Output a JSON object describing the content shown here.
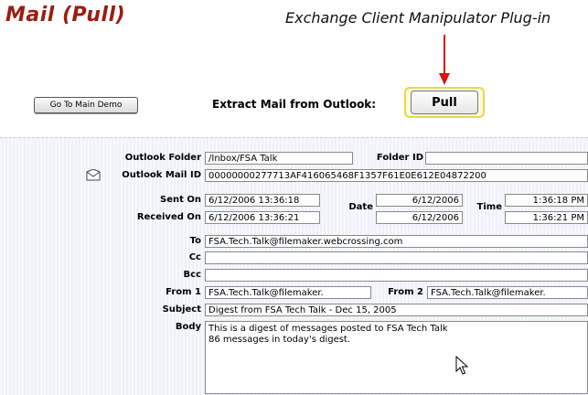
{
  "header": {
    "title": "Mail (Pull)",
    "subtitle": "Exchange Client Manipulator Plug-in"
  },
  "toolbar": {
    "go_to_main_demo": "Go To Main Demo",
    "extract_label": "Extract Mail from Outlook:",
    "pull_label": "Pull"
  },
  "form": {
    "outlook_folder_label": "Outlook Folder",
    "outlook_folder_value": "/Inbox/FSA Talk",
    "folder_id_label": "Folder ID",
    "folder_id_value": "",
    "mail_id_label": "Outlook Mail ID",
    "mail_id_value": "00000000277713AF416065468F1357F61E0E612E04872200",
    "sent_on_label": "Sent On",
    "sent_on_value": "6/12/2006 13:36:18",
    "received_on_label": "Received On",
    "received_on_value": "6/12/2006 13:36:21",
    "date_label": "Date",
    "sent_date_value": "6/12/2006",
    "received_date_value": "6/12/2006",
    "time_label": "Time",
    "sent_time_value": "1:36:18 PM",
    "received_time_value": "1:36:21 PM",
    "to_label": "To",
    "to_value": "FSA.Tech.Talk@filemaker.webcrossing.com",
    "cc_label": "Cc",
    "cc_value": "",
    "bcc_label": "Bcc",
    "bcc_value": "",
    "from1_label": "From 1",
    "from1_value": "FSA.Tech.Talk@filemaker.",
    "from2_label": "From 2",
    "from2_value": "FSA.Tech.Talk@filemaker.",
    "subject_label": "Subject",
    "subject_value": "Digest from FSA Tech Talk - Dec 15, 2005",
    "body_label": "Body",
    "body_value": "This is a digest of messages posted to FSA Tech Talk\n86 messages in today's digest."
  },
  "colors": {
    "title": "#9b1c12",
    "arrow": "#dd1111",
    "pull_highlight": "#e8d84a"
  }
}
